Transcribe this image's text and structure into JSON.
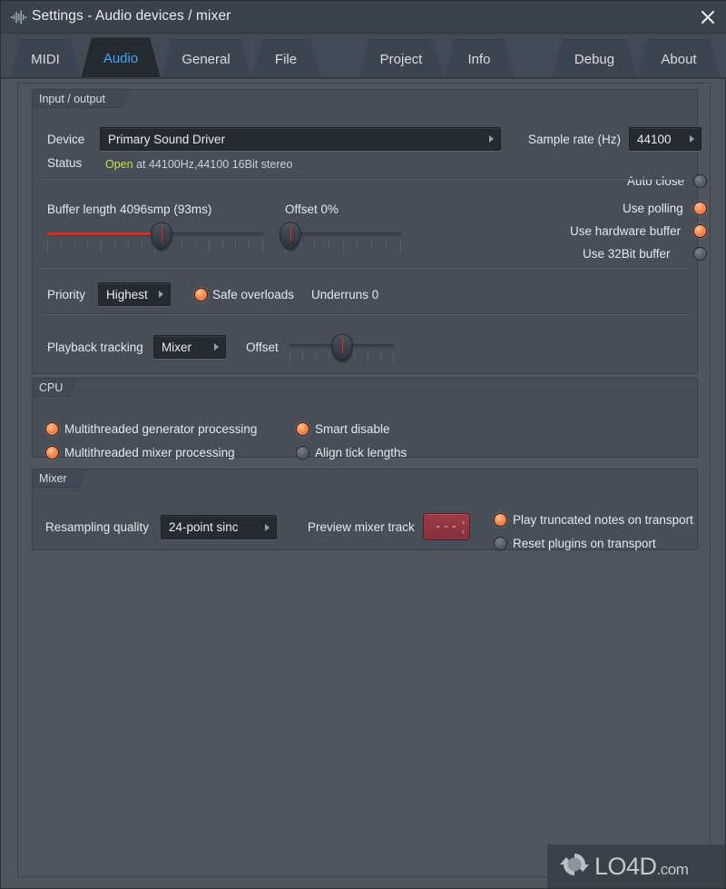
{
  "window": {
    "title": "Settings - Audio devices / mixer",
    "app_icon": "waveform-icon",
    "close_icon": "close-icon"
  },
  "tabs": [
    {
      "label": "MIDI",
      "active": false
    },
    {
      "label": "Audio",
      "active": true
    },
    {
      "label": "General",
      "active": false
    },
    {
      "label": "File",
      "active": false
    },
    {
      "label": "Project",
      "active": false
    },
    {
      "label": "Info",
      "active": false
    },
    {
      "label": "Debug",
      "active": false
    },
    {
      "label": "About",
      "active": false
    }
  ],
  "input_output": {
    "panel_title": "Input / output",
    "device_label": "Device",
    "device_value": "Primary Sound Driver",
    "status_label": "Status",
    "status_open": "Open",
    "status_detail": "at 44100Hz,44100 16Bit stereo",
    "sample_rate_label": "Sample rate (Hz)",
    "sample_rate_value": "44100",
    "auto_close_label": "Auto close",
    "auto_close_state": "off",
    "buffer_label": "Buffer length 4096smp (93ms)",
    "buffer_percent": 53,
    "offset_label": "Offset 0%",
    "offset_percent": 5,
    "use_polling_label": "Use polling",
    "use_polling_state": "on",
    "use_hardware_buffer_label": "Use hardware buffer",
    "use_hardware_buffer_state": "on",
    "use_32bit_buffer_label": "Use 32Bit buffer",
    "use_32bit_buffer_state": "off",
    "priority_label": "Priority",
    "priority_value": "Highest",
    "safe_overloads_label": "Safe overloads",
    "safe_overloads_state": "on",
    "underruns_label": "Underruns 0",
    "playback_tracking_label": "Playback tracking",
    "playback_tracking_value": "Mixer",
    "playback_offset_label": "Offset",
    "playback_offset_percent": 50
  },
  "cpu": {
    "panel_title": "CPU",
    "options": [
      {
        "label": "Multithreaded generator processing",
        "state": "on"
      },
      {
        "label": "Multithreaded mixer processing",
        "state": "on"
      },
      {
        "label": "Smart disable",
        "state": "on"
      },
      {
        "label": "Align tick lengths",
        "state": "off"
      }
    ]
  },
  "mixer": {
    "panel_title": "Mixer",
    "resampling_label": "Resampling quality",
    "resampling_value": "24-point sinc",
    "preview_track_label": "Preview mixer track",
    "preview_track_value": "---",
    "preview_chevron_up": "›",
    "preview_chevron_down": "‹",
    "options": [
      {
        "label": "Play truncated notes on transport",
        "state": "on"
      },
      {
        "label": "Reset plugins on transport",
        "state": "off"
      }
    ]
  },
  "watermark": {
    "text": "LO4D",
    "suffix": ".com",
    "logo_icon": "refresh-circle-icon"
  },
  "colors": {
    "accent_blue": "#3fa9f5",
    "led_on": "#ff8a4d",
    "status_green": "#c8e04a",
    "slider_red": "#e02b20",
    "track_red": "#83313d"
  }
}
